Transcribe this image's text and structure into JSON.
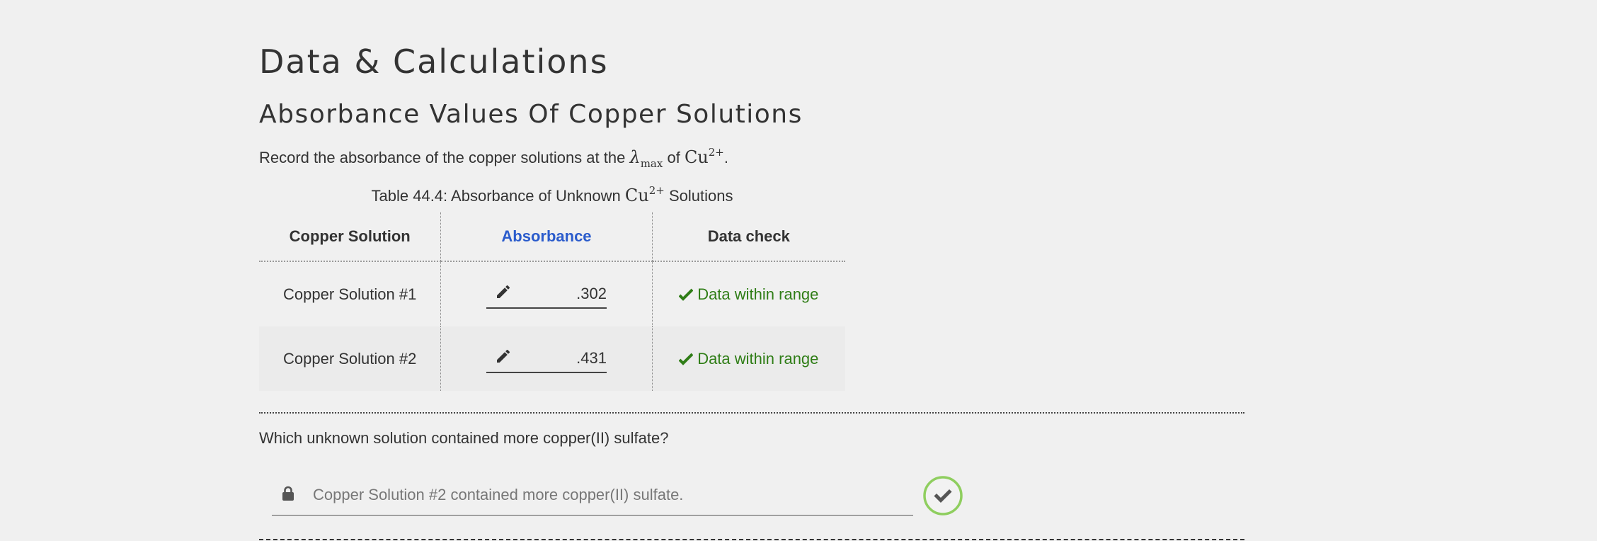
{
  "page": {
    "title": "Data & Calculations",
    "section_title": "Absorbance Values Of Copper Solutions",
    "intro_text": "Record the absorbance of the copper solutions at the",
    "intro_lambda": "λ",
    "intro_lambda_sub": "max",
    "intro_of": "of",
    "intro_cu": "Cu",
    "intro_cu_sup": "2+",
    "intro_end": "."
  },
  "table": {
    "caption_prefix": "Table 44.4: Absorbance of Unknown",
    "caption_cu": "Cu",
    "caption_cu_sup": "2+",
    "caption_suffix": "Solutions",
    "headers": [
      "Copper Solution",
      "Absorbance",
      "Data check"
    ],
    "rows": [
      {
        "solution": "Copper Solution #1",
        "absorbance": ".302",
        "check": "Data within range"
      },
      {
        "solution": "Copper Solution #2",
        "absorbance": ".431",
        "check": "Data within range"
      }
    ],
    "accent_color": "#2b5ccc",
    "check_color": "#2f7d16"
  },
  "question": {
    "text": "Which unknown solution contained more copper(II) sulfate?",
    "answer": "Copper Solution #2 contained more copper(II) sulfate.",
    "submit_ring_color": "#8fce5f"
  },
  "icons": {
    "edit": "pencil-icon",
    "check": "checkmark-icon",
    "lock": "lock-icon",
    "submit": "check-circle-icon"
  }
}
